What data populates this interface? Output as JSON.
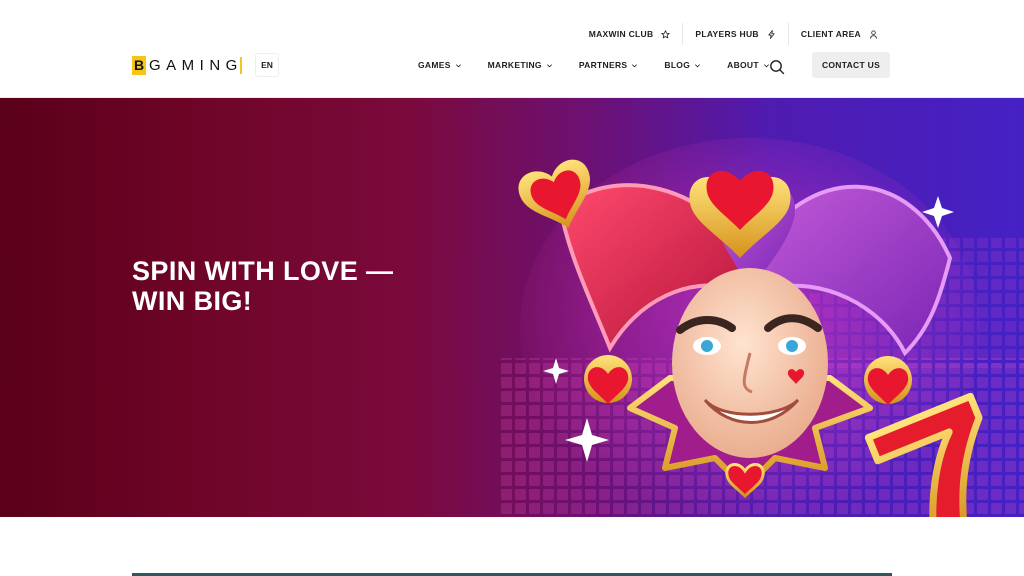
{
  "header": {
    "topbar": [
      {
        "label": "MAXWIN CLUB",
        "icon": "star-icon"
      },
      {
        "label": "PLAYERS HUB",
        "icon": "lightning-icon"
      },
      {
        "label": "CLIENT AREA",
        "icon": "user-icon"
      }
    ],
    "logo": {
      "first": "B",
      "rest": "GAMING"
    },
    "language": "EN",
    "nav": [
      {
        "label": "GAMES"
      },
      {
        "label": "MARKETING"
      },
      {
        "label": "PARTNERS"
      },
      {
        "label": "BLOG"
      },
      {
        "label": "ABOUT"
      }
    ],
    "contact_label": "CONTACT US"
  },
  "hero": {
    "title_line1": "SPIN WITH LOVE —",
    "title_line2": "WIN BIG!",
    "image": "joker-jester-illustration"
  },
  "colors": {
    "brand_yellow": "#f7c51a",
    "hero_left": "#5a0019",
    "hero_right": "#4521c4"
  }
}
